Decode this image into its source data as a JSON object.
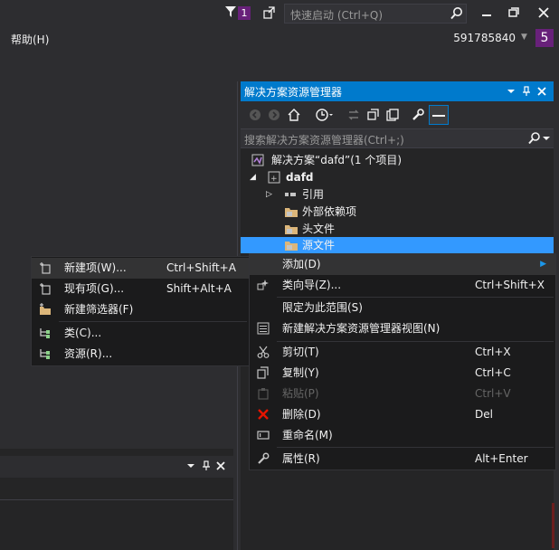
{
  "topbar": {
    "notif_count": "1",
    "quicklaunch_placeholder": "快速启动 (Ctrl+Q)"
  },
  "menubar": {
    "help": "帮助(H)",
    "account": "591785840",
    "badge": "5"
  },
  "solution_explorer": {
    "title": "解决方案资源管理器",
    "search_placeholder": "搜索解决方案资源管理器(Ctrl+;)",
    "tree": [
      {
        "label": "解决方案“dafd”(1 个项目)"
      },
      {
        "label": "dafd"
      },
      {
        "label": "引用"
      },
      {
        "label": "外部依赖项"
      },
      {
        "label": "头文件"
      },
      {
        "label": "源文件"
      }
    ]
  },
  "context_menu": {
    "items": [
      {
        "label": "添加(D)",
        "shortcut": ""
      },
      {
        "label": "类向导(Z)...",
        "shortcut": "Ctrl+Shift+X"
      },
      {
        "label": "限定为此范围(S)",
        "shortcut": ""
      },
      {
        "label": "新建解决方案资源管理器视图(N)",
        "shortcut": ""
      },
      {
        "label": "剪切(T)",
        "shortcut": "Ctrl+X"
      },
      {
        "label": "复制(Y)",
        "shortcut": "Ctrl+C"
      },
      {
        "label": "粘贴(P)",
        "shortcut": "Ctrl+V"
      },
      {
        "label": "删除(D)",
        "shortcut": "Del"
      },
      {
        "label": "重命名(M)",
        "shortcut": ""
      },
      {
        "label": "属性(R)",
        "shortcut": "Alt+Enter"
      }
    ]
  },
  "submenu": {
    "items": [
      {
        "label": "新建项(W)...",
        "shortcut": "Ctrl+Shift+A"
      },
      {
        "label": "现有项(G)...",
        "shortcut": "Shift+Alt+A"
      },
      {
        "label": "新建筛选器(F)",
        "shortcut": ""
      },
      {
        "label": "类(C)...",
        "shortcut": ""
      },
      {
        "label": "资源(R)...",
        "shortcut": ""
      }
    ]
  },
  "colors": {
    "accent": "#007acc",
    "vs_purple": "#68217a",
    "selection": "#3399ff"
  }
}
